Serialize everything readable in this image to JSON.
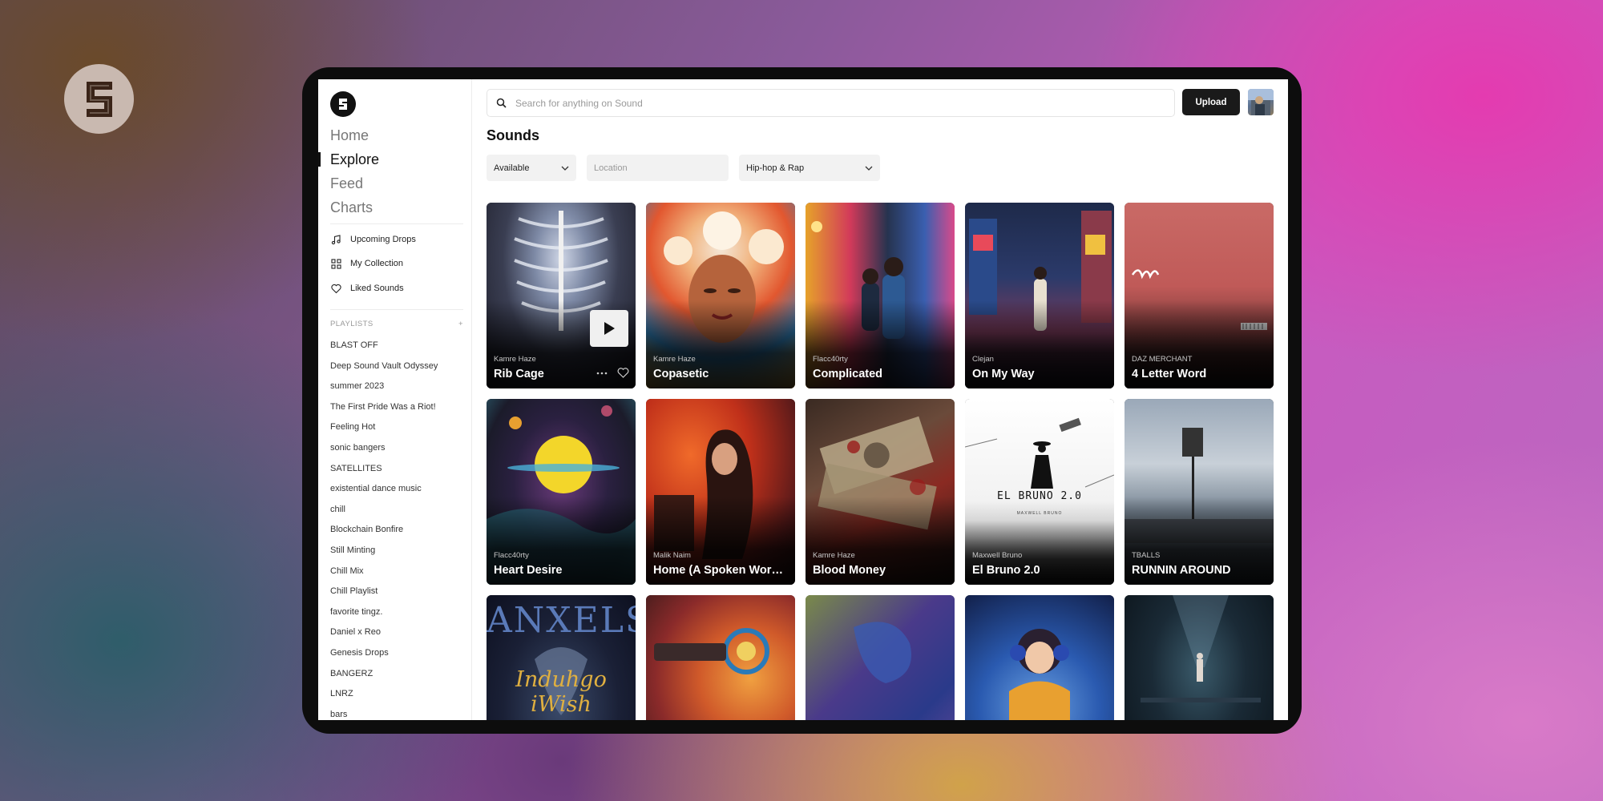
{
  "search": {
    "placeholder": "Search for anything on Sound"
  },
  "header": {
    "upload_label": "Upload"
  },
  "nav": {
    "primary": [
      {
        "label": "Home",
        "active": false
      },
      {
        "label": "Explore",
        "active": true
      },
      {
        "label": "Feed",
        "active": false
      },
      {
        "label": "Charts",
        "active": false
      }
    ],
    "secondary": [
      {
        "label": "Upcoming Drops",
        "icon": "music-note-icon"
      },
      {
        "label": "My Collection",
        "icon": "grid-icon"
      },
      {
        "label": "Liked Sounds",
        "icon": "heart-icon"
      }
    ]
  },
  "playlists": {
    "heading": "PLAYLISTS",
    "add_label": "+",
    "items": [
      "BLAST OFF",
      "Deep Sound Vault Odyssey",
      "summer 2023",
      "The First Pride Was a Riot!",
      "Feeling Hot",
      "sonic bangers",
      "SATELLITES",
      "existential dance music",
      "chill",
      "Blockchain Bonfire",
      "Still Minting",
      "Chill Mix",
      "Chill Playlist",
      "favorite tingz.",
      "Daniel x Reo",
      "Genesis Drops",
      "BANGERZ",
      "LNRZ",
      "bars"
    ]
  },
  "main": {
    "title": "Sounds"
  },
  "filters": {
    "availability": "Available",
    "location_placeholder": "Location",
    "genre": "Hip-hop & Rap"
  },
  "cards": [
    {
      "artist": "Kamre Haze",
      "title": "Rib Cage"
    },
    {
      "artist": "Kamre Haze",
      "title": "Copasetic"
    },
    {
      "artist": "Flacc40rty",
      "title": "Complicated"
    },
    {
      "artist": "Clejan",
      "title": "On My Way"
    },
    {
      "artist": "DAZ MERCHANT",
      "title": "4 Letter Word"
    },
    {
      "artist": "Flacc40rty",
      "title": "Heart Desire"
    },
    {
      "artist": "Malik Naim",
      "title": "Home (A Spoken Word..."
    },
    {
      "artist": "Kamre Haze",
      "title": "Blood Money"
    },
    {
      "artist": "Maxwell Bruno",
      "title": "El Bruno 2.0"
    },
    {
      "artist": "TBALLS",
      "title": "RUNNIN AROUND"
    }
  ],
  "artwork_text": {
    "anxels_top": "ANXELS",
    "anxels_bottom": "Induhgo iWish",
    "bruno_title": "EL BRUNO 2.0",
    "bruno_sub": "MAXWELL BRUNO"
  },
  "colors": {
    "accent": "#1a1a1a",
    "page_bg": "#ffffff",
    "muted": "#777777"
  }
}
